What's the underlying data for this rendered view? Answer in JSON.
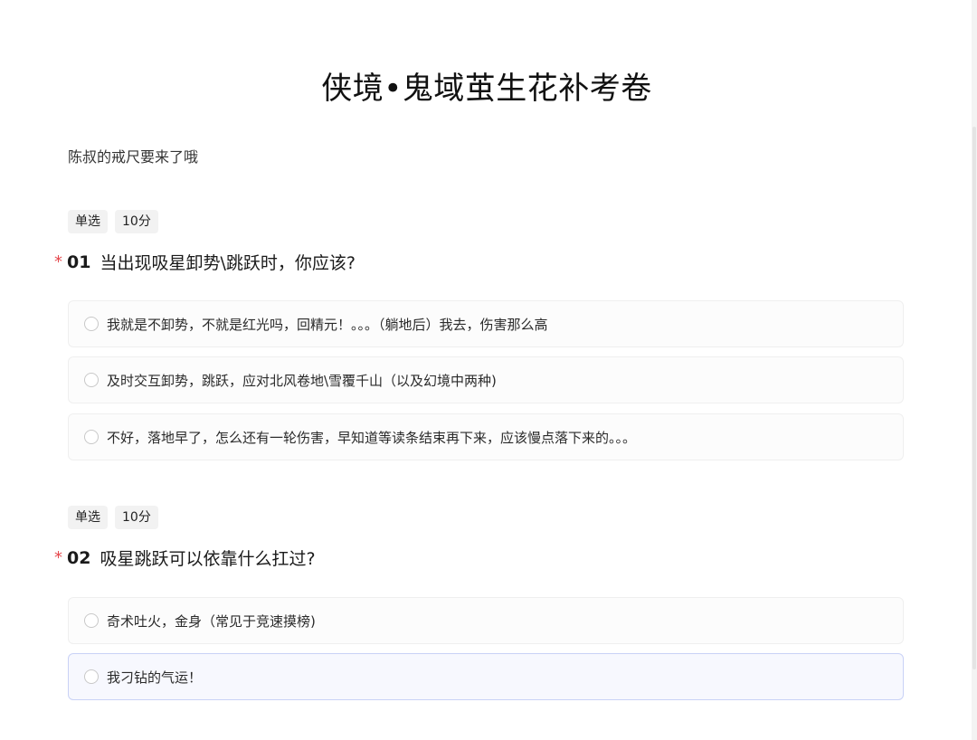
{
  "survey": {
    "title": "侠境•鬼域茧生花补考卷",
    "description": "陈叔的戒尺要来了哦"
  },
  "questions": [
    {
      "type_tag": "单选",
      "score_tag": "10分",
      "required_mark": "*",
      "number": "01",
      "text": "当出现吸星卸势\\跳跃时，你应该?",
      "options": [
        {
          "label": "我就是不卸势，不就是红光吗，回精元！。。。（躺地后）我去，伤害那么高"
        },
        {
          "label": "及时交互卸势，跳跃，应对北风卷地\\雪覆千山（以及幻境中两种)"
        },
        {
          "label": "不好，落地早了，怎么还有一轮伤害，早知道等读条结束再下来，应该慢点落下来的。。。"
        }
      ]
    },
    {
      "type_tag": "单选",
      "score_tag": "10分",
      "required_mark": "*",
      "number": "02",
      "text": "吸星跳跃可以依靠什么扛过?",
      "options": [
        {
          "label": "奇术吐火，金身（常见于竞速摸榜)"
        },
        {
          "label": "我刁钻的气运！"
        }
      ]
    }
  ],
  "colors": {
    "required": "#e5484d",
    "hover_border": "#c9d2f6",
    "tag_bg": "#f2f2f2"
  }
}
